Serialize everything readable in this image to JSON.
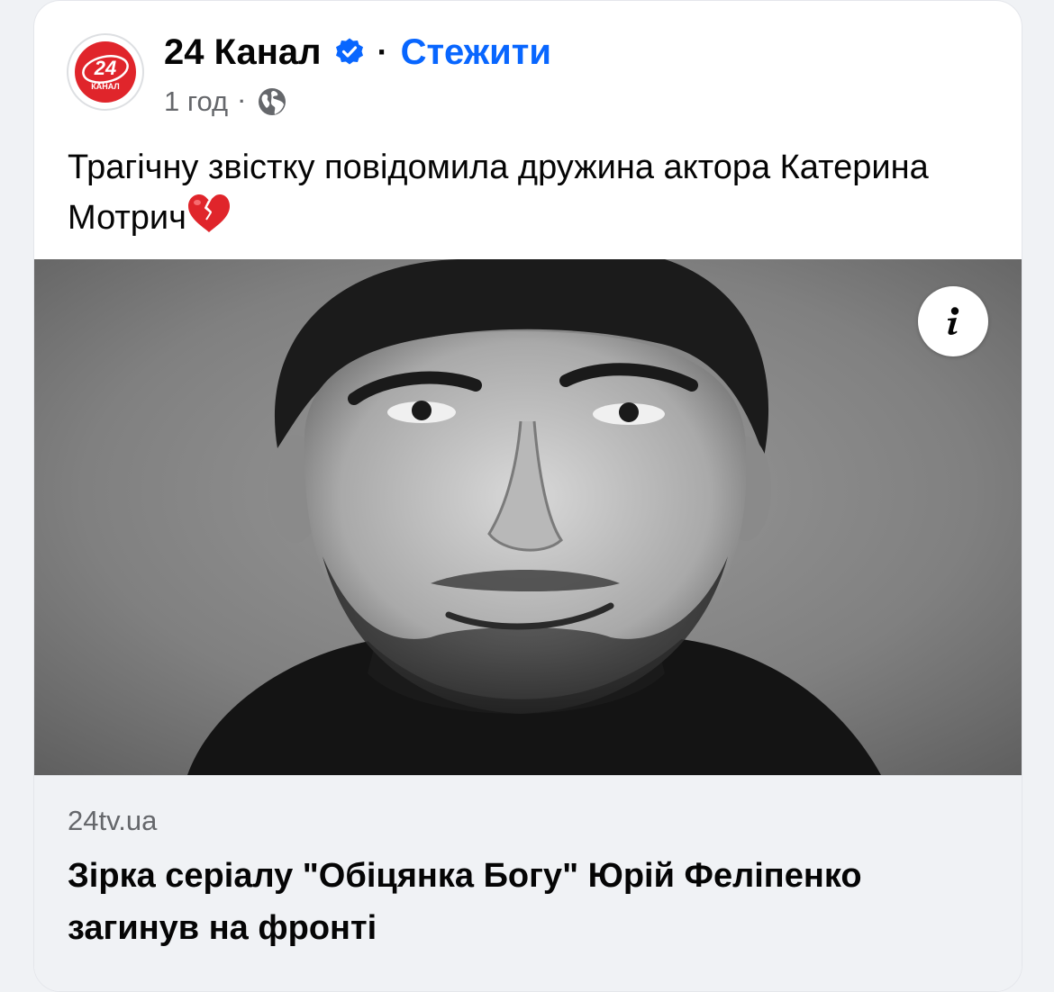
{
  "post": {
    "page_name": "24 Канал",
    "follow_label": "Стежити",
    "separator": "·",
    "time": "1 год",
    "meta_separator": "·",
    "audience_icon": "globe-icon",
    "verified_icon": "verified-badge-icon",
    "logo_text_top": "24",
    "logo_text_bottom": "КАНАЛ",
    "text": "Трагічну звістку повідомила дружина актора Катерина Мотрич",
    "text_emoji": "broken-heart-icon"
  },
  "media": {
    "alt": "Black and white portrait photo",
    "info_icon": "info-icon"
  },
  "link_preview": {
    "domain": "24tv.ua",
    "title": "Зірка серіалу \"Обіцянка Богу\" Юрій Феліпенко загинув на фронті"
  },
  "colors": {
    "accent": "#0866ff",
    "logo_red": "#e0252b",
    "text_primary": "#050505",
    "text_secondary": "#65676b"
  }
}
